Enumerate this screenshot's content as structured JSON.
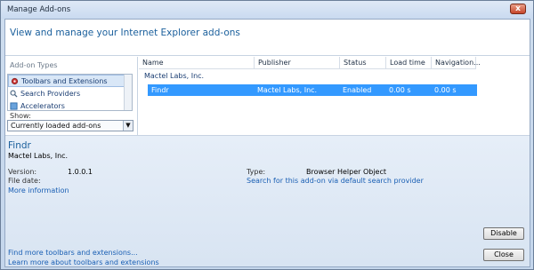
{
  "window": {
    "title": "Manage Add-ons"
  },
  "header": {
    "headline": "View and manage your Internet Explorer add-ons"
  },
  "left": {
    "group_label": "Add-on Types",
    "items": [
      {
        "label": "Toolbars and Extensions",
        "icon": "gear-icon"
      },
      {
        "label": "Search Providers",
        "icon": "search-icon"
      },
      {
        "label": "Accelerators",
        "icon": "accelerator-icon"
      }
    ],
    "show_label": "Show:",
    "show_value": "Currently loaded add-ons"
  },
  "grid": {
    "columns": [
      "Name",
      "Publisher",
      "Status",
      "Load time",
      "Navigation..."
    ],
    "group": "Mactel Labs, Inc.",
    "rows": [
      {
        "name": "Findr",
        "publisher": "Mactel Labs, Inc.",
        "status": "Enabled",
        "load_time": "0.00 s",
        "navigation": "0.00 s"
      }
    ]
  },
  "details": {
    "name": "Findr",
    "publisher": "Mactel Labs, Inc.",
    "version_label": "Version:",
    "version_value": "1.0.0.1",
    "filedate_label": "File date:",
    "more_info": "More information",
    "type_label": "Type:",
    "type_value": "Browser Helper Object",
    "search_link": "Search for this add-on via default search provider"
  },
  "footer": {
    "link1": "Find more toolbars and extensions...",
    "link2": "Learn more about toolbars and extensions",
    "disable": "Disable",
    "close": "Close"
  }
}
